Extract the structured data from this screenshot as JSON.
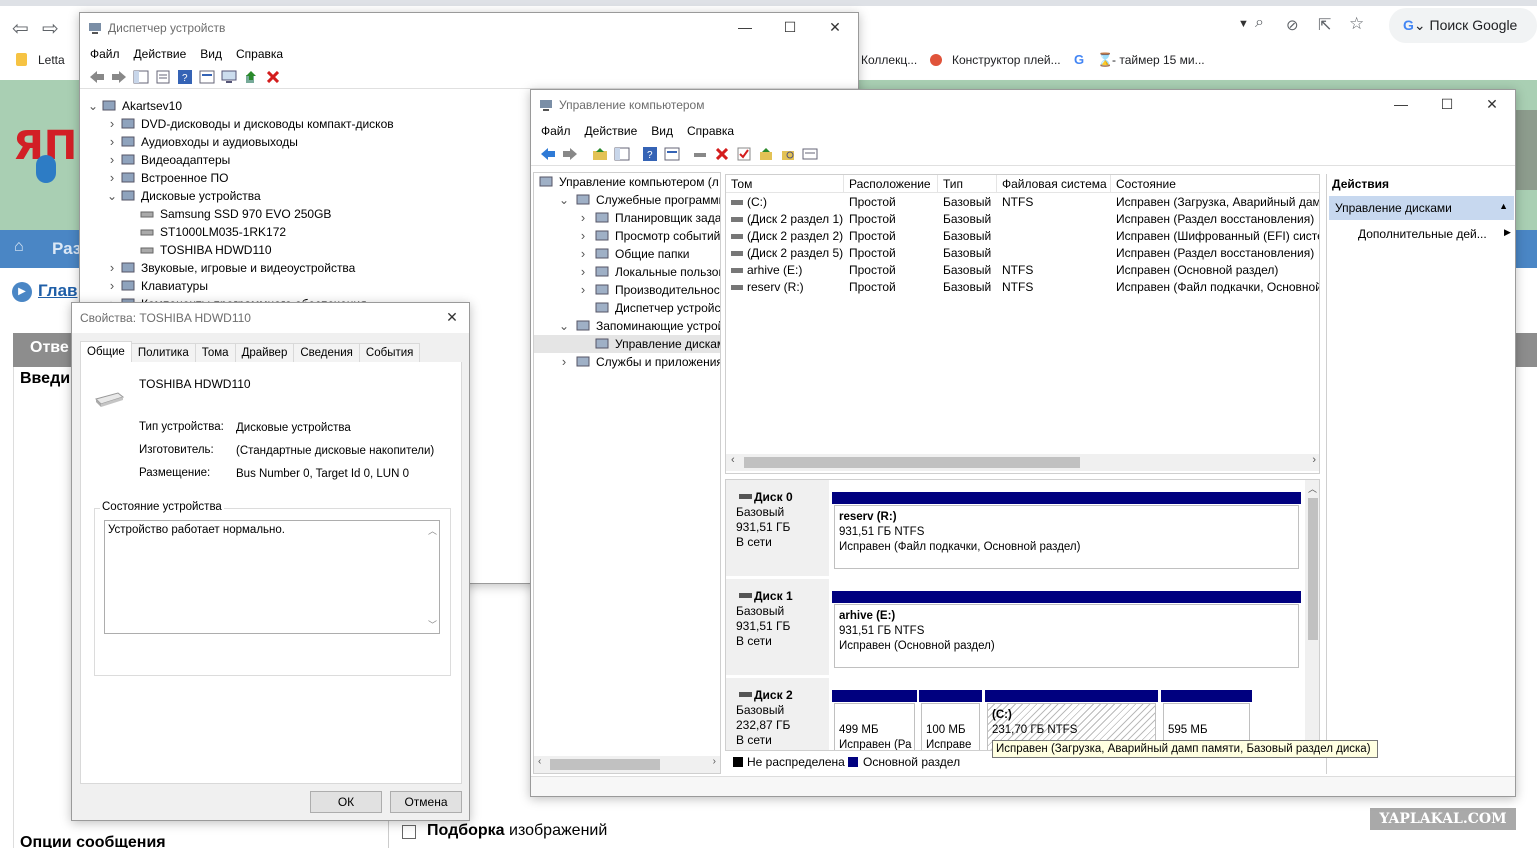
{
  "browser": {
    "search_placeholder": "Поиск Google",
    "bookmarks": [
      "Letta",
      "Коллекц...",
      "Конструктор плей...",
      "- таймер 15 ми..."
    ],
    "site_nav": "Раз",
    "site_link": "Глав",
    "site_panel": "Отве",
    "site_input_label": "Введи",
    "site_options": "Опции сообщения",
    "site_checkbox_label_bold": "Подборка",
    "site_checkbox_label": " изображений",
    "watermark": "YAPLAKAL.COM"
  },
  "devmgr": {
    "title": "Диспетчер устройств",
    "menu": [
      "Файл",
      "Действие",
      "Вид",
      "Справка"
    ],
    "tree": [
      {
        "label": "Akartsev10",
        "level": 0,
        "exp": "open"
      },
      {
        "label": "DVD-дисководы и дисководы компакт-дисков",
        "level": 1,
        "exp": "closed"
      },
      {
        "label": "Аудиовходы и аудиовыходы",
        "level": 1,
        "exp": "closed"
      },
      {
        "label": "Видеоадаптеры",
        "level": 1,
        "exp": "closed"
      },
      {
        "label": "Встроенное ПО",
        "level": 1,
        "exp": "closed"
      },
      {
        "label": "Дисковые устройства",
        "level": 1,
        "exp": "open"
      },
      {
        "label": "Samsung SSD 970 EVO 250GB",
        "level": 2,
        "exp": "none"
      },
      {
        "label": "ST1000LM035-1RK172",
        "level": 2,
        "exp": "none"
      },
      {
        "label": "TOSHIBA HDWD110",
        "level": 2,
        "exp": "none"
      },
      {
        "label": "Звуковые, игровые и видеоустройства",
        "level": 1,
        "exp": "closed"
      },
      {
        "label": "Клавиатуры",
        "level": 1,
        "exp": "closed"
      },
      {
        "label": "Компоненты программного обеспечения",
        "level": 1,
        "exp": "closed"
      }
    ]
  },
  "props": {
    "title": "Свойства: TOSHIBA HDWD110",
    "tabs": [
      "Общие",
      "Политика",
      "Тома",
      "Драйвер",
      "Сведения",
      "События"
    ],
    "device_name": "TOSHIBA HDWD110",
    "type_label": "Тип устройства:",
    "type_value": "Дисковые устройства",
    "mfr_label": "Изготовитель:",
    "mfr_value": "(Стандартные дисковые накопители)",
    "loc_label": "Размещение:",
    "loc_value": "Bus Number 0, Target Id 0, LUN 0",
    "status_group": "Состояние устройства",
    "status_text": "Устройство работает нормально.",
    "ok": "ОК",
    "cancel": "Отмена"
  },
  "compmgmt": {
    "title": "Управление компьютером",
    "menu": [
      "Файл",
      "Действие",
      "Вид",
      "Справка"
    ],
    "tree": [
      {
        "label": "Управление компьютером (л",
        "level": 0,
        "exp": "none"
      },
      {
        "label": "Служебные программы",
        "level": 1,
        "exp": "open"
      },
      {
        "label": "Планировщик заданий",
        "level": 2,
        "exp": "closed"
      },
      {
        "label": "Просмотр событий",
        "level": 2,
        "exp": "closed"
      },
      {
        "label": "Общие папки",
        "level": 2,
        "exp": "closed"
      },
      {
        "label": "Локальные пользовате",
        "level": 2,
        "exp": "closed"
      },
      {
        "label": "Производительность",
        "level": 2,
        "exp": "closed"
      },
      {
        "label": "Диспетчер устройств",
        "level": 2,
        "exp": "none"
      },
      {
        "label": "Запоминающие устройст",
        "level": 1,
        "exp": "open"
      },
      {
        "label": "Управление дисками",
        "level": 2,
        "exp": "none"
      },
      {
        "label": "Службы и приложения",
        "level": 1,
        "exp": "closed"
      }
    ],
    "columns": [
      "Том",
      "Расположение",
      "Тип",
      "Файловая система",
      "Состояние"
    ],
    "volumes": [
      {
        "vol": "(C:)",
        "loc": "Простой",
        "type": "Базовый",
        "fs": "NTFS",
        "state": "Исправен (Загрузка, Аварийный дам"
      },
      {
        "vol": "(Диск 2 раздел 1)",
        "loc": "Простой",
        "type": "Базовый",
        "fs": "",
        "state": "Исправен (Раздел восстановления)"
      },
      {
        "vol": "(Диск 2 раздел 2)",
        "loc": "Простой",
        "type": "Базовый",
        "fs": "",
        "state": "Исправен (Шифрованный (EFI) систе"
      },
      {
        "vol": "(Диск 2 раздел 5)",
        "loc": "Простой",
        "type": "Базовый",
        "fs": "",
        "state": "Исправен (Раздел восстановления)"
      },
      {
        "vol": "arhive (E:)",
        "loc": "Простой",
        "type": "Базовый",
        "fs": "NTFS",
        "state": "Исправен (Основной раздел)"
      },
      {
        "vol": "reserv (R:)",
        "loc": "Простой",
        "type": "Базовый",
        "fs": "NTFS",
        "state": "Исправен (Файл подкачки, Основной"
      }
    ],
    "disks": [
      {
        "name": "Диск 0",
        "kind": "Базовый",
        "size": "931,51 ГБ",
        "status": "В сети",
        "part_name": "reserv  (R:)",
        "part_size": "931,51 ГБ NTFS",
        "part_state": "Исправен (Файл подкачки, Основной раздел)"
      },
      {
        "name": "Диск 1",
        "kind": "Базовый",
        "size": "931,51 ГБ",
        "status": "В сети",
        "part_name": "arhive  (E:)",
        "part_size": "931,51 ГБ NTFS",
        "part_state": "Исправен (Основной раздел)"
      },
      {
        "name": "Диск 2",
        "kind": "Базовый",
        "size": "232,87 ГБ",
        "status": "В сети"
      }
    ],
    "disk2_parts": [
      {
        "name": "",
        "size": "499 МБ",
        "state": "Исправен (Ра"
      },
      {
        "name": "",
        "size": "100 МБ",
        "state": "Исправе"
      },
      {
        "name": "(C:)",
        "size": "231,70 ГБ NTFS",
        "state": ""
      },
      {
        "name": "",
        "size": "595 МБ",
        "state": ""
      }
    ],
    "tooltip": "Исправен (Загрузка, Аварийный дамп памяти, Базовый раздел диска)",
    "legend": [
      "Не распределена",
      "Основной раздел"
    ],
    "actions_header": "Действия",
    "actions_section": "Управление дисками",
    "actions_more": "Дополнительные дей..."
  }
}
